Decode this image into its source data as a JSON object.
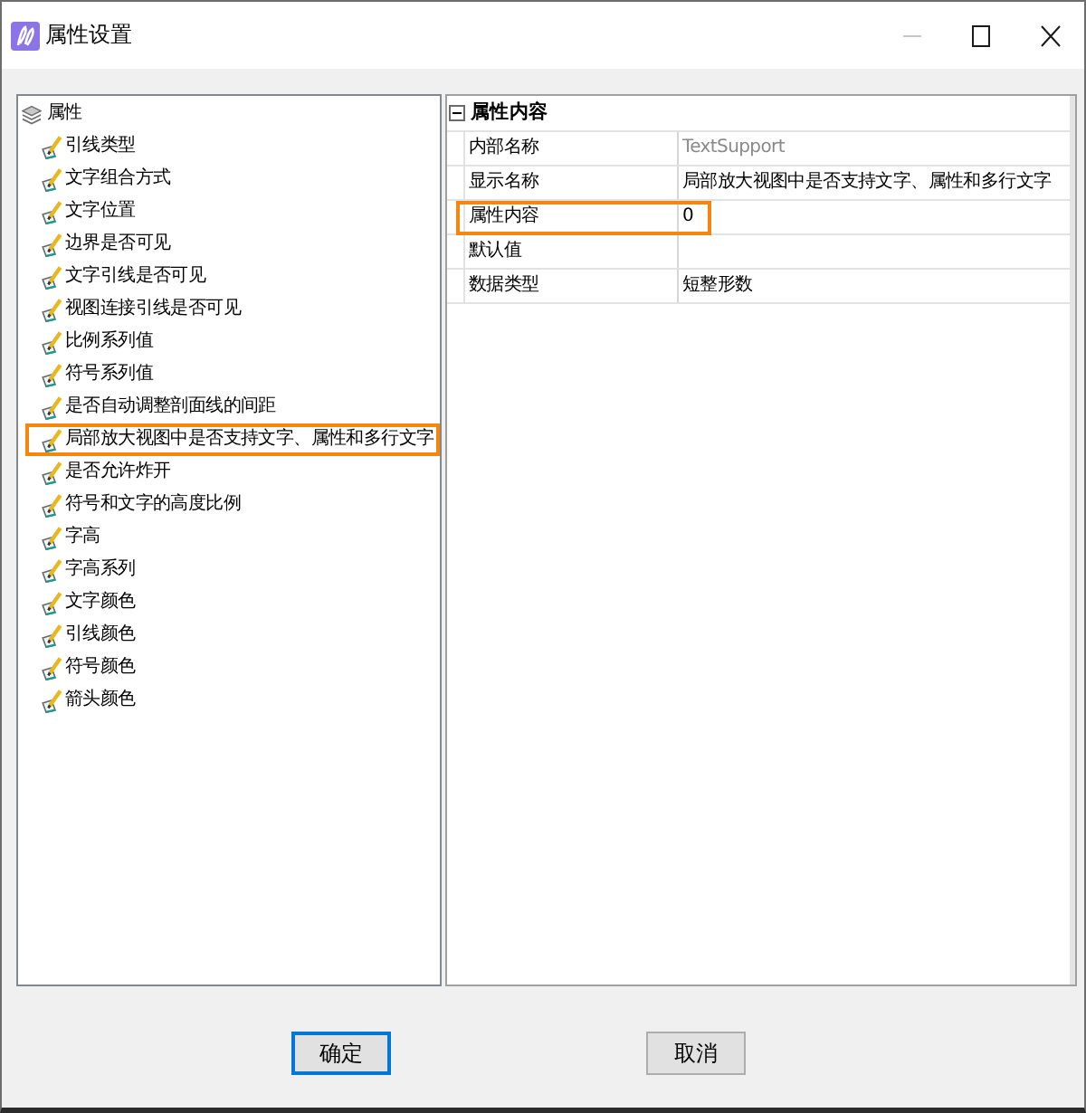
{
  "window": {
    "title": "属性设置",
    "controls": [
      {
        "kind": "minimize",
        "disabled": true
      },
      {
        "kind": "maximize",
        "disabled": false
      },
      {
        "kind": "close",
        "disabled": false
      }
    ]
  },
  "tree": {
    "label": "属性",
    "children": [
      {
        "label": "引线类型",
        "highlighted": false
      },
      {
        "label": "文字组合方式",
        "highlighted": false
      },
      {
        "label": "文字位置",
        "highlighted": false
      },
      {
        "label": "边界是否可见",
        "highlighted": false
      },
      {
        "label": "文字引线是否可见",
        "highlighted": false
      },
      {
        "label": "视图连接引线是否可见",
        "highlighted": false
      },
      {
        "label": "比例系列值",
        "highlighted": false
      },
      {
        "label": "符号系列值",
        "highlighted": false
      },
      {
        "label": "是否自动调整剖面线的间距",
        "highlighted": false
      },
      {
        "label": "局部放大视图中是否支持文字、属性和多行文字",
        "highlighted": true
      },
      {
        "label": "是否允许炸开",
        "highlighted": false
      },
      {
        "label": "符号和文字的高度比例",
        "highlighted": false
      },
      {
        "label": "字高",
        "highlighted": false
      },
      {
        "label": "字高系列",
        "highlighted": false
      },
      {
        "label": "文字颜色",
        "highlighted": false
      },
      {
        "label": "引线颜色",
        "highlighted": false
      },
      {
        "label": "符号颜色",
        "highlighted": false
      },
      {
        "label": "箭头颜色",
        "highlighted": false
      }
    ]
  },
  "property_grid": {
    "section": {
      "label": "属性内容",
      "expanded": true
    },
    "rows": [
      {
        "name": "内部名称",
        "value": "TextSupport",
        "readonly": true,
        "highlighted": false
      },
      {
        "name": "显示名称",
        "value": "局部放大视图中是否支持文字、属性和多行文字",
        "readonly": false,
        "highlighted": false
      },
      {
        "name": "属性内容",
        "value": "0",
        "readonly": false,
        "highlighted": true
      },
      {
        "name": "默认值",
        "readonly": false,
        "highlighted": false
      },
      {
        "name": "数据类型",
        "value": "短整形数",
        "readonly": false,
        "highlighted": false
      }
    ]
  },
  "buttons": [
    {
      "label": "确定",
      "default": true
    },
    {
      "label": "取消",
      "default": false
    }
  ]
}
